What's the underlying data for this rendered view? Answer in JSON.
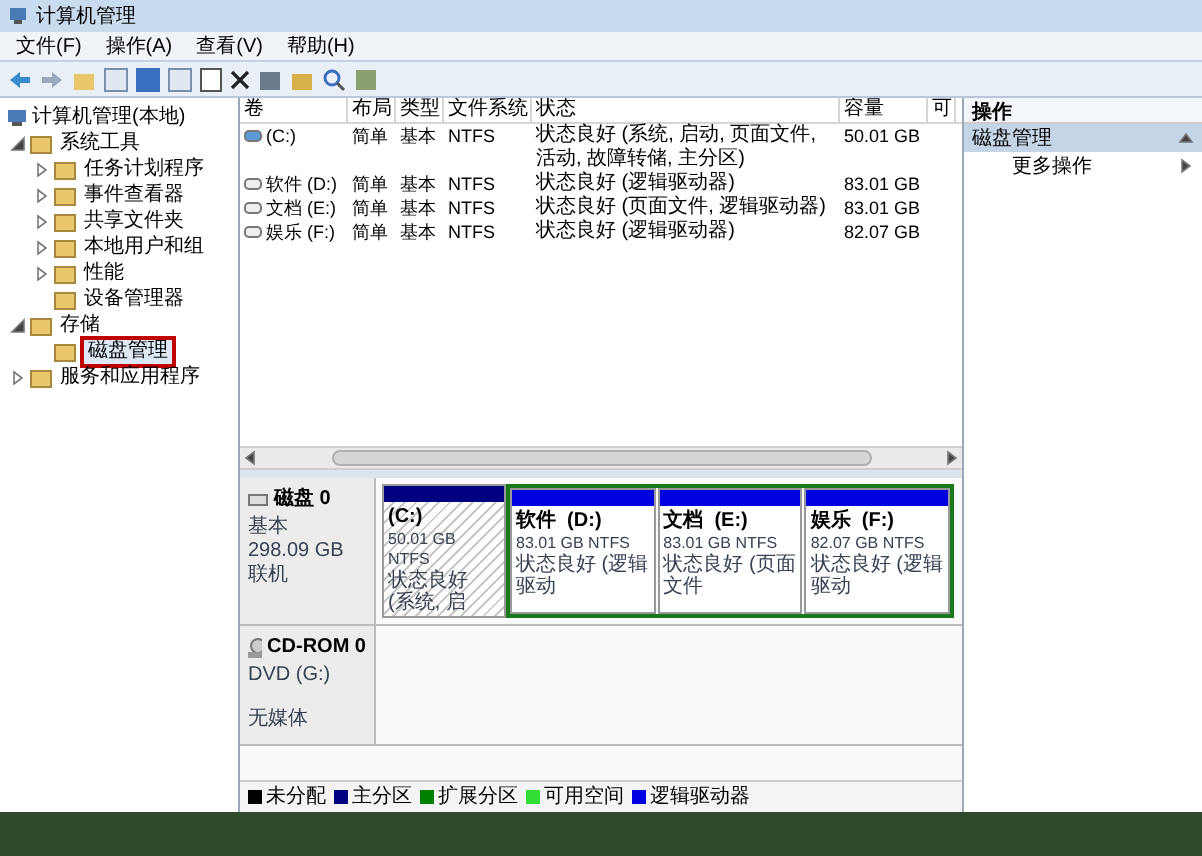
{
  "window": {
    "title": "计算机管理"
  },
  "menu": [
    "文件(F)",
    "操作(A)",
    "查看(V)",
    "帮助(H)"
  ],
  "tree": {
    "label": "计算机管理(本地)",
    "children": [
      {
        "label": "系统工具",
        "expanded": true,
        "selected": false,
        "children": [
          {
            "label": "任务计划程序",
            "expanded": false,
            "selected": false
          },
          {
            "label": "事件查看器",
            "expanded": false,
            "selected": false
          },
          {
            "label": "共享文件夹",
            "expanded": false,
            "selected": false
          },
          {
            "label": "本地用户和组",
            "expanded": false,
            "selected": false
          },
          {
            "label": "性能",
            "expanded": false,
            "selected": false
          },
          {
            "label": "设备管理器",
            "selected": false
          }
        ]
      },
      {
        "label": "存储",
        "expanded": true,
        "selected": false,
        "children": [
          {
            "label": "磁盘管理",
            "selected": true
          }
        ]
      },
      {
        "label": "服务和应用程序",
        "expanded": false,
        "selected": false
      }
    ]
  },
  "volume_table": {
    "columns": [
      "卷",
      "布局",
      "类型",
      "文件系统",
      "状态",
      "容量",
      "可"
    ],
    "rows": [
      {
        "cells": [
          "(C:)",
          "简单",
          "基本",
          "NTFS",
          "状态良好 (系统, 启动, 页面文件, 活动, 故障转储, 主分区)",
          "50.01 GB"
        ],
        "kind": "system"
      },
      {
        "cells": [
          "软件 (D:)",
          "简单",
          "基本",
          "NTFS",
          "状态良好 (逻辑驱动器)",
          "83.01 GB"
        ],
        "kind": "logical"
      },
      {
        "cells": [
          "文档 (E:)",
          "简单",
          "基本",
          "NTFS",
          "状态良好 (页面文件, 逻辑驱动器)",
          "83.01 GB"
        ],
        "kind": "logical"
      },
      {
        "cells": [
          "娱乐 (F:)",
          "简单",
          "基本",
          "NTFS",
          "状态良好 (逻辑驱动器)",
          "82.07 GB"
        ],
        "kind": "logical"
      }
    ]
  },
  "disks": [
    {
      "name": "磁盘 0",
      "kind": "disk",
      "lines": [
        "基本",
        "298.09 GB",
        "联机"
      ],
      "partitions": [
        {
          "name": "(C:)",
          "size": "50.01 GB NTFS",
          "status": "状态良好 (系统, 启",
          "kind": "primary"
        },
        {
          "name": "软件  (D:)",
          "size": "83.01 GB NTFS",
          "status": "状态良好 (逻辑驱动",
          "kind": "logical"
        },
        {
          "name": "文档  (E:)",
          "size": "83.01 GB NTFS",
          "status": "状态良好 (页面文件",
          "kind": "logical"
        },
        {
          "name": "娱乐  (F:)",
          "size": "82.07 GB NTFS",
          "status": "状态良好 (逻辑驱动",
          "kind": "logical"
        }
      ]
    },
    {
      "name": "CD-ROM 0",
      "kind": "cdrom",
      "lines": [
        "DVD (G:)",
        "无媒体"
      ]
    }
  ],
  "legend": [
    {
      "label": "未分配",
      "color": "#000000"
    },
    {
      "label": "主分区",
      "color": "#000080"
    },
    {
      "label": "扩展分区",
      "color": "#008000"
    },
    {
      "label": "可用空间",
      "color": "#33dd33"
    },
    {
      "label": "逻辑驱动器",
      "color": "#0000e0"
    }
  ],
  "actions": {
    "title": "操作",
    "section": "磁盘管理",
    "items": [
      "更多操作"
    ]
  }
}
